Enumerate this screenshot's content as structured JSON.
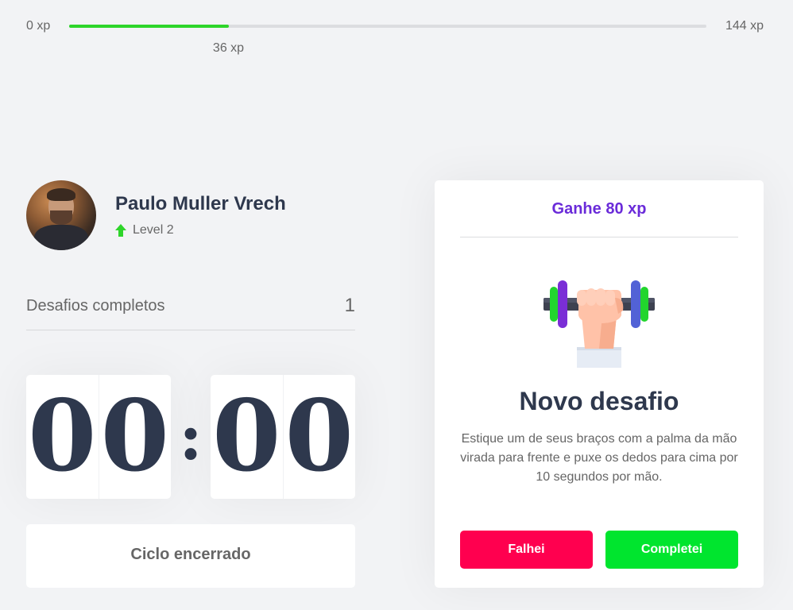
{
  "xp": {
    "min_label": "0 xp",
    "max_label": "144 xp",
    "current_label": "36 xp",
    "progress": 0.25
  },
  "profile": {
    "name": "Paulo Muller Vrech",
    "level": "Level 2",
    "level_icon": "level-up-arrow-icon"
  },
  "completed": {
    "label": "Desafios completos",
    "count": "1"
  },
  "countdown": {
    "minutes": [
      "0",
      "0"
    ],
    "separator": ":",
    "seconds": [
      "0",
      "0"
    ]
  },
  "cycle_button": {
    "label": "Ciclo encerrado"
  },
  "challenge": {
    "header": "Ganhe 80 xp",
    "icon": "dumbbell-hand-icon",
    "title": "Novo desafio",
    "description": "Estique um de seus braços com a palma da mão virada para frente e puxe os dedos para cima por 10 segundos por mão.",
    "fail_label": "Falhei",
    "success_label": "Completei"
  },
  "colors": {
    "background": "#f2f3f5",
    "text": "#666666",
    "title": "#2e384d",
    "xp_fill": "#2ed52a",
    "header_accent": "#6a2bd9",
    "fail": "#ff004f",
    "success": "#00e52e"
  }
}
